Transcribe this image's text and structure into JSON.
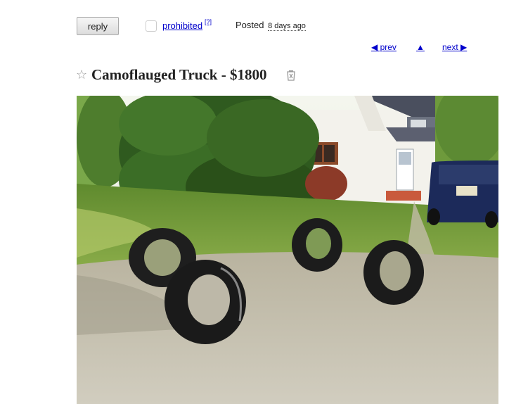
{
  "actions": {
    "reply_label": "reply"
  },
  "flag": {
    "label": "prohibited",
    "help": "[?]"
  },
  "posting": {
    "posted_label": "Posted",
    "posted_when": "8 days ago"
  },
  "nav": {
    "prev": "◀ prev",
    "up": "▲",
    "next": "next ▶"
  },
  "listing": {
    "title": "Camoflauged Truck - $1800"
  },
  "icons": {
    "favorite": "star-icon",
    "hide": "hide-icon",
    "prev": "left-triangle-icon",
    "up": "up-triangle-icon",
    "next": "right-triangle-icon"
  },
  "photo": {
    "description": "listing photo",
    "scene": [
      "lawn",
      "gravel-driveway",
      "four-tires",
      "white-house",
      "tree",
      "navy-suv"
    ]
  }
}
